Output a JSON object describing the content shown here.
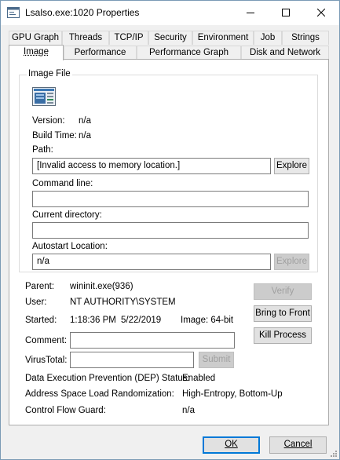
{
  "window": {
    "title": "Lsalso.exe:1020 Properties"
  },
  "tabs_top": [
    "GPU Graph",
    "Threads",
    "TCP/IP",
    "Security",
    "Environment",
    "Job",
    "Strings"
  ],
  "tabs_bottom": [
    "Image",
    "Performance",
    "Performance Graph",
    "Disk and Network"
  ],
  "image_file": {
    "group_label": "Image File",
    "version_label": "Version:",
    "version_value": "n/a",
    "build_time_label": "Build Time:",
    "build_time_value": "n/a",
    "path_label": "Path:",
    "path_value": "[Invalid access to memory location.]",
    "explore_label": "Explore",
    "command_line_label": "Command line:",
    "command_line_value": "",
    "current_directory_label": "Current directory:",
    "current_directory_value": "",
    "autostart_label": "Autostart Location:",
    "autostart_value": "n/a",
    "explore2_label": "Explore"
  },
  "details": {
    "parent_label": "Parent:",
    "parent_value": "wininit.exe(936)",
    "user_label": "User:",
    "user_value": "NT AUTHORITY\\SYSTEM",
    "started_label": "Started:",
    "started_time": "1:18:36 PM",
    "started_date": "5/22/2019",
    "image_bits": "Image: 64-bit",
    "comment_label": "Comment:",
    "comment_value": "",
    "virustotal_label": "VirusTotal:",
    "virustotal_value": "",
    "submit_label": "Submit",
    "dep_label": "Data Execution Prevention (DEP) Status:",
    "dep_value": "Enabled",
    "aslr_label": "Address Space Load Randomization:",
    "aslr_value": "High-Entropy, Bottom-Up",
    "cfg_label": "Control Flow Guard:",
    "cfg_value": "n/a"
  },
  "actions": {
    "verify": "Verify",
    "bring_to_front": "Bring to Front",
    "kill_process": "Kill Process"
  },
  "footer": {
    "ok": "OK",
    "cancel": "Cancel"
  }
}
